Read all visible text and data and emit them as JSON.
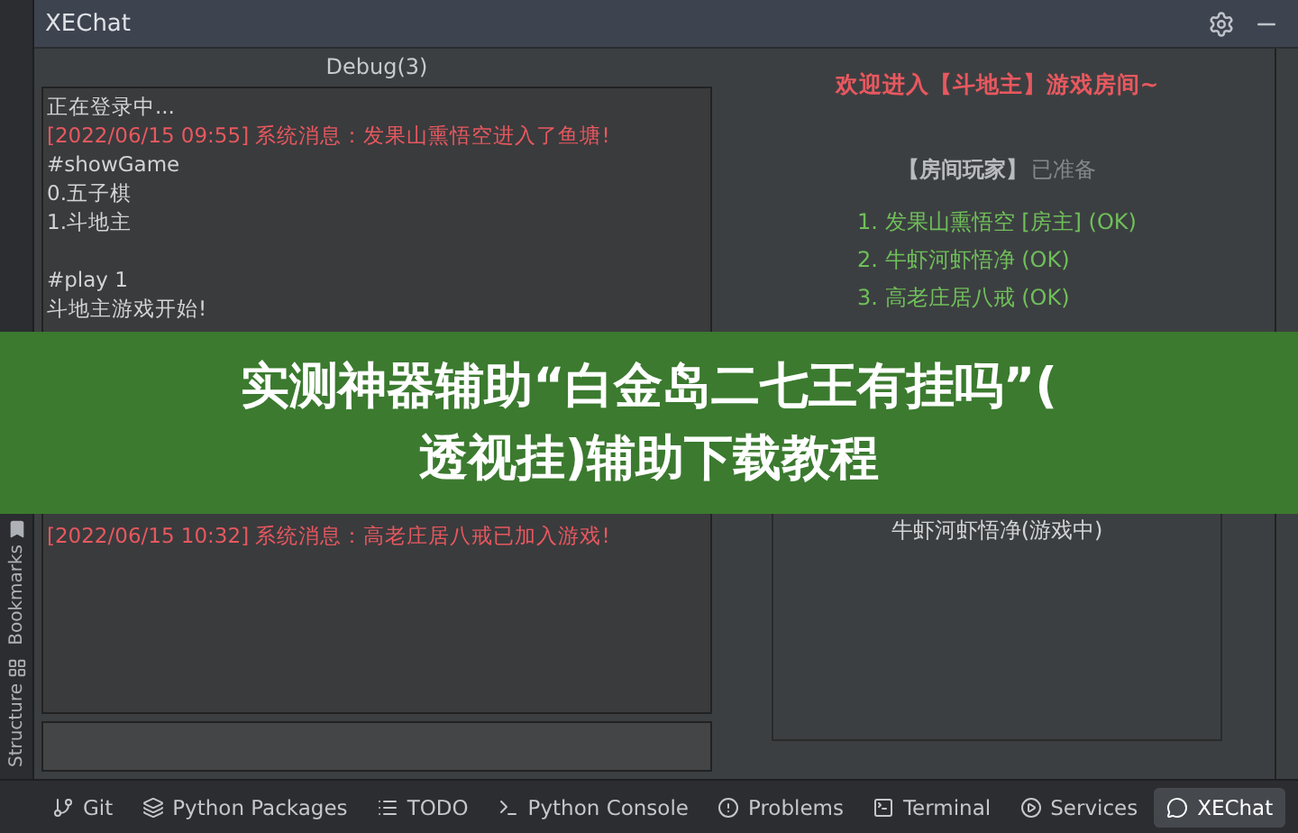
{
  "window": {
    "title": "XEChat"
  },
  "debug": {
    "title": "Debug(3)",
    "lines_before_banner": [
      {
        "kind": "normal",
        "text": "正在登录中..."
      },
      {
        "kind": "system",
        "text": "[2022/06/15 09:55] 系统消息：发果山熏悟空进入了鱼塘!"
      },
      {
        "kind": "normal",
        "text": "#showGame"
      },
      {
        "kind": "normal",
        "text": "0.五子棋"
      },
      {
        "kind": "normal",
        "text": "1.斗地主"
      },
      {
        "kind": "blank"
      },
      {
        "kind": "normal",
        "text": "#play 1"
      },
      {
        "kind": "normal",
        "text": "斗地主游戏开始!"
      }
    ],
    "lines_after_banner": [
      {
        "kind": "system",
        "text": "[2022/06/15 10:32] 系统消息：高老庄居八戒已加入游戏!"
      }
    ]
  },
  "room": {
    "welcome": "欢迎进入【斗地主】游戏房间~",
    "players_heading": "【房间玩家】",
    "players_status": "已准备",
    "players": [
      "1. 发果山熏悟空 [房主] (OK)",
      "2. 牛虾河虾悟净 (OK)",
      "3. 高老庄居八戒 (OK)"
    ],
    "online_after_banner": [
      "牛虾河虾悟净(游戏中)"
    ]
  },
  "side_tabs": [
    "Bookmarks",
    "Structure"
  ],
  "tool_tabs": [
    {
      "kind": "git",
      "label": "Git",
      "selected": false
    },
    {
      "kind": "packages",
      "label": "Python Packages",
      "selected": false
    },
    {
      "kind": "todo",
      "label": "TODO",
      "selected": false
    },
    {
      "kind": "console",
      "label": "Python Console",
      "selected": false
    },
    {
      "kind": "problems",
      "label": "Problems",
      "selected": false
    },
    {
      "kind": "terminal",
      "label": "Terminal",
      "selected": false
    },
    {
      "kind": "services",
      "label": "Services",
      "selected": false
    },
    {
      "kind": "chat",
      "label": "XEChat",
      "selected": true
    }
  ],
  "banner": {
    "lines": [
      "实测神器辅助“白金岛二七王有挂吗”(",
      "透视挂)辅助下载教程"
    ]
  }
}
